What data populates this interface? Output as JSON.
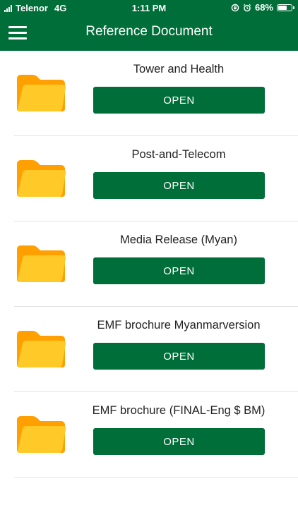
{
  "status_bar": {
    "carrier": "Telenor",
    "network": "4G",
    "time": "1:11 PM",
    "battery_percent_label": "68%",
    "battery_level": 0.68
  },
  "header": {
    "title": "Reference Document",
    "menu_icon": "hamburger-menu-icon"
  },
  "documents": [
    {
      "title": "Tower and Health",
      "button_label": "OPEN"
    },
    {
      "title": "Post-and-Telecom",
      "button_label": "OPEN"
    },
    {
      "title": "Media Release (Myan)",
      "button_label": "OPEN"
    },
    {
      "title": "EMF brochure Myanmarversion",
      "button_label": "OPEN"
    },
    {
      "title": "EMF brochure (FINAL-Eng $ BM)",
      "button_label": "OPEN"
    }
  ],
  "icons": {
    "document": "folder-icon"
  },
  "colors": {
    "primary_green": "#006e38",
    "folder_back": "#ffa000",
    "folder_front": "#ffca28",
    "divider": "#e3e3e3"
  }
}
